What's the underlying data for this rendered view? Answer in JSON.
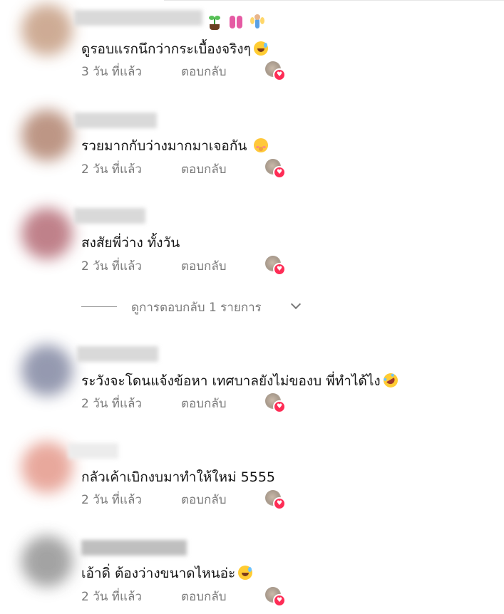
{
  "comments": [
    {
      "text": "ดูรอบแรกนึกว่ากระเบื้องจริงๆ",
      "emoji": "grinning-sweat-emoji",
      "time": "3 วัน ที่แล้ว",
      "reply": "ตอบกลับ",
      "avatar_color": "#c9a38a"
    },
    {
      "text": "รวยมากกับว่างมากมาเจอกัน",
      "emoji": "shushing-face-emoji",
      "time": "2 วัน ที่แล้ว",
      "reply": "ตอบกลับ",
      "avatar_color": "#b68b78"
    },
    {
      "text": "สงสัยพี่ว่าง ทั้งวัน",
      "emoji": "",
      "time": "2 วัน ที่แล้ว",
      "reply": "ตอบกลับ",
      "avatar_color": "#b9747e"
    },
    {
      "text": "ระวังจะโดนแจ้งข้อหา เทศบาลยังไม่ของบ พี่ทำได้ไง",
      "emoji": "rolling-laughing-emoji",
      "time": "2 วัน ที่แล้ว",
      "reply": "ตอบกลับ",
      "avatar_color": "#8a8fa8"
    },
    {
      "text": "กลัวเค้าเบิกงบมาทำให้ใหม่ 5555",
      "emoji": "",
      "time": "2 วัน ที่แล้ว",
      "reply": "ตอบกลับ",
      "avatar_color": "#e69f92"
    },
    {
      "text": "เอ้าดิ่ ต้องว่างขนาดไหนอ่ะ",
      "emoji": "grinning-sweat-emoji",
      "time": "2 วัน ที่แล้ว",
      "reply": "ตอบกลับ",
      "avatar_color": "#9a9a9a"
    }
  ],
  "view_replies": {
    "label": "ดูการตอบกลับ 1 รายการ"
  },
  "top_emojis": [
    "seedling-icon",
    "slippers-icon",
    "fairy-icon"
  ],
  "colors": {
    "text_primary": "#161616",
    "text_secondary": "#7a7a7a",
    "heart_badge": "#fe2c55"
  }
}
